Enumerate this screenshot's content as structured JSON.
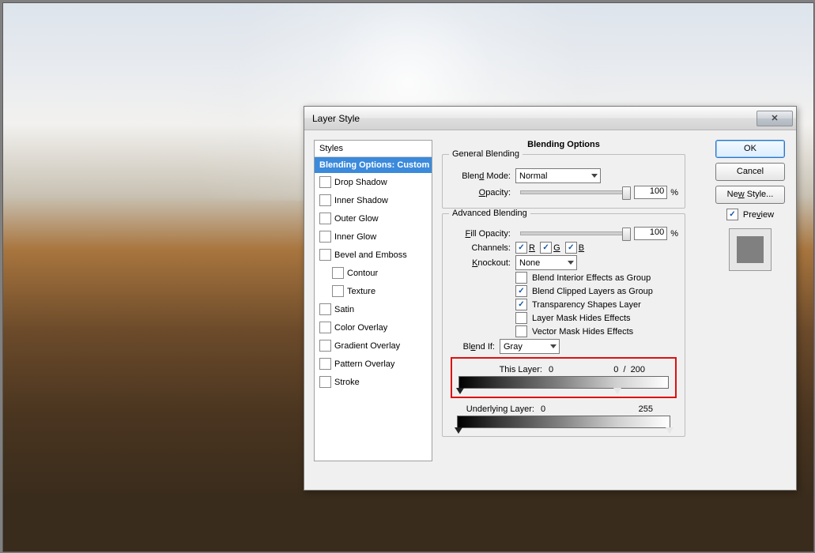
{
  "dialog": {
    "title": "Layer Style",
    "close_glyph": "✕"
  },
  "styles_panel": {
    "header": "Styles",
    "active": "Blending Options: Custom",
    "items": [
      "Drop Shadow",
      "Inner Shadow",
      "Outer Glow",
      "Inner Glow",
      "Bevel and Emboss",
      "Contour",
      "Texture",
      "Satin",
      "Color Overlay",
      "Gradient Overlay",
      "Pattern Overlay",
      "Stroke"
    ]
  },
  "center": {
    "title": "Blending Options",
    "general": {
      "legend": "General Blending",
      "blend_mode_label": "Blend Mode:",
      "blend_mode_value": "Normal",
      "opacity_label": "Opacity:",
      "opacity_value": "100",
      "pct": "%"
    },
    "advanced": {
      "legend": "Advanced Blending",
      "fill_opacity_label": "Fill Opacity:",
      "fill_opacity_value": "100",
      "channels_label": "Channels:",
      "chan_r": "R",
      "chan_g": "G",
      "chan_b": "B",
      "knockout_label": "Knockout:",
      "knockout_value": "None",
      "opt1": "Blend Interior Effects as Group",
      "opt2": "Blend Clipped Layers as Group",
      "opt3": "Transparency Shapes Layer",
      "opt4": "Layer Mask Hides Effects",
      "opt5": "Vector Mask Hides Effects"
    },
    "blendif": {
      "label": "Blend If:",
      "value": "Gray",
      "this_layer_label": "This Layer:",
      "this_layer_low": "0",
      "this_layer_high_a": "0",
      "this_layer_sep": "/",
      "this_layer_high_b": "200",
      "underlying_label": "Underlying Layer:",
      "underlying_low": "0",
      "underlying_high": "255"
    }
  },
  "right": {
    "ok": "OK",
    "cancel": "Cancel",
    "new_style": "New Style...",
    "preview_label": "Preview"
  }
}
